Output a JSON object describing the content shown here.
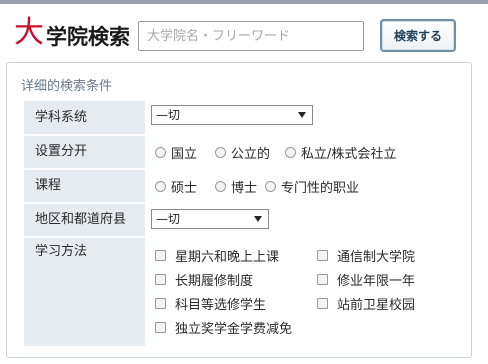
{
  "header": {
    "title_first_char": "大",
    "title_rest": "学院検索",
    "search_placeholder": "大学院名・フリーワード",
    "search_button_label": "検索する"
  },
  "panel": {
    "title": "详细的検索条件",
    "rows": {
      "field": {
        "label": "学科系统",
        "select_value": "—切"
      },
      "establishment": {
        "label": "设置分开",
        "options": [
          "国立",
          "公立的",
          "私立/株式会社立"
        ]
      },
      "course": {
        "label": "课程",
        "options": [
          "硕士",
          "博士",
          "专门性的职业"
        ]
      },
      "region": {
        "label": "地区和都道府县",
        "select_value": "—切"
      },
      "study_method": {
        "label": "学习方法",
        "options": [
          "星期六和晚上上课",
          "通信制大学院",
          "长期履修制度",
          "修业年限一年",
          "科目等选修学生",
          "站前卫星校园",
          "独立奖学金学费减免"
        ]
      }
    }
  },
  "colors": {
    "title_accent": "#c8102e",
    "label_background": "#e6ebf0",
    "panel_border": "#c9d3dc",
    "button_border": "#6d8fa8"
  }
}
